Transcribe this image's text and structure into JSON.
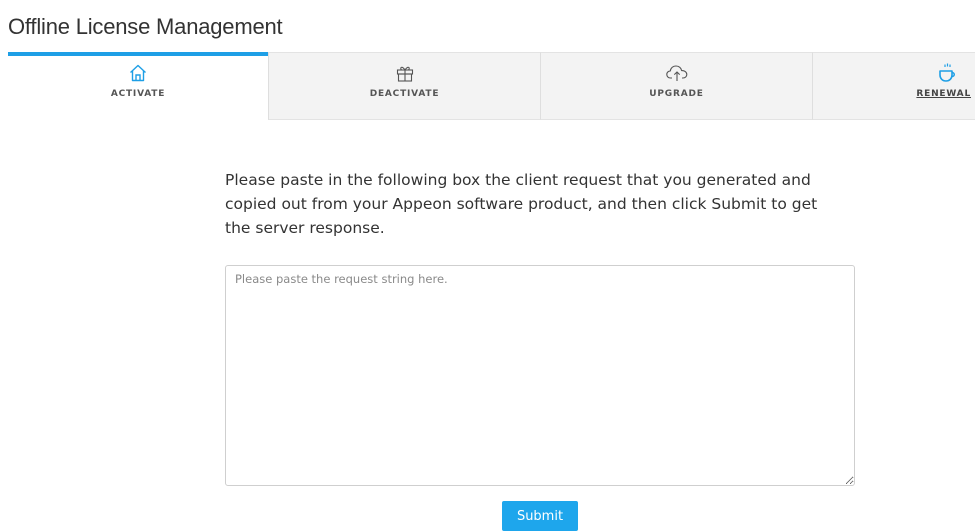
{
  "page": {
    "title": "Offline License Management"
  },
  "tabs": [
    {
      "label": "ACTIVATE",
      "icon": "home-icon",
      "active": true
    },
    {
      "label": "DEACTIVATE",
      "icon": "gift-icon",
      "active": false
    },
    {
      "label": "UPGRADE",
      "icon": "cloud-upload-icon",
      "active": false
    },
    {
      "label": "RENEWAL",
      "icon": "coffee-cup-icon",
      "active": false
    }
  ],
  "main": {
    "instructions": "Please paste in the following box the client request that you generated and copied out from your Appeon software product, and then click Submit to get the server response.",
    "request_placeholder": "Please paste the request string here.",
    "request_value": "",
    "submit_label": "Submit"
  },
  "colors": {
    "accent": "#1e9fe6",
    "button": "#1ea6ec",
    "tab_inactive_bg": "#f3f3f3"
  }
}
